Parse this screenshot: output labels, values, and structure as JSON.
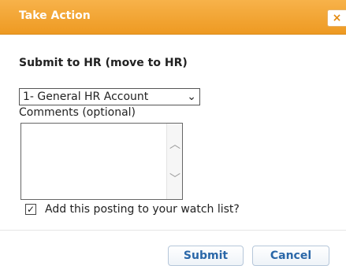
{
  "dialog": {
    "title": "Take Action",
    "close_icon": "×"
  },
  "form": {
    "heading": "Submit to HR (move to HR)",
    "account_select": {
      "selected": "1- General HR Account",
      "chevron_icon": "⌄"
    },
    "comments_label": "Comments (optional)",
    "comments_value": "",
    "scroll_up_icon": "︿",
    "scroll_down_icon": "﹀",
    "watch_checkbox": {
      "checked": true,
      "check_icon": "✓",
      "label": "Add this posting to your watch list?"
    }
  },
  "buttons": {
    "submit_label": "Submit",
    "cancel_label": "Cancel"
  },
  "colors": {
    "titlebar": "#ee9a22",
    "button_text": "#2a67a8"
  }
}
